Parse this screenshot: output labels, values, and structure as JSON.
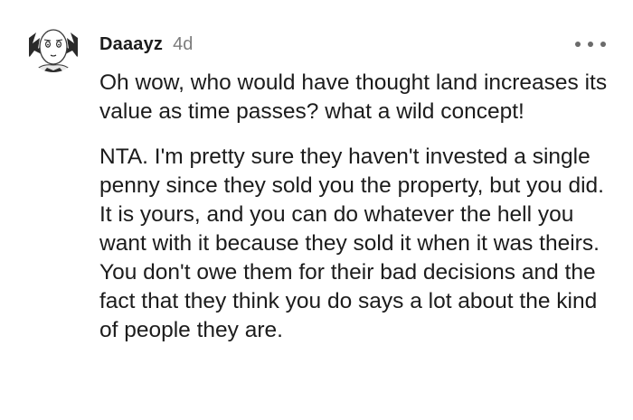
{
  "comment": {
    "avatar_icon": "anime-character-avatar",
    "username": "Daaayz",
    "timestamp": "4d",
    "more_icon": "more-options-icon",
    "paragraphs": [
      "Oh wow, who would have thought land increases its value as time passes? what a wild concept!",
      "NTA. I'm pretty sure they haven't invested a single penny since they sold you the property, but you did. It is yours, and you can do whatever the hell you want with it because they sold it when it was theirs. You don't owe them for their bad decisions and the fact that they think you do says a lot about the kind of people they are."
    ]
  }
}
